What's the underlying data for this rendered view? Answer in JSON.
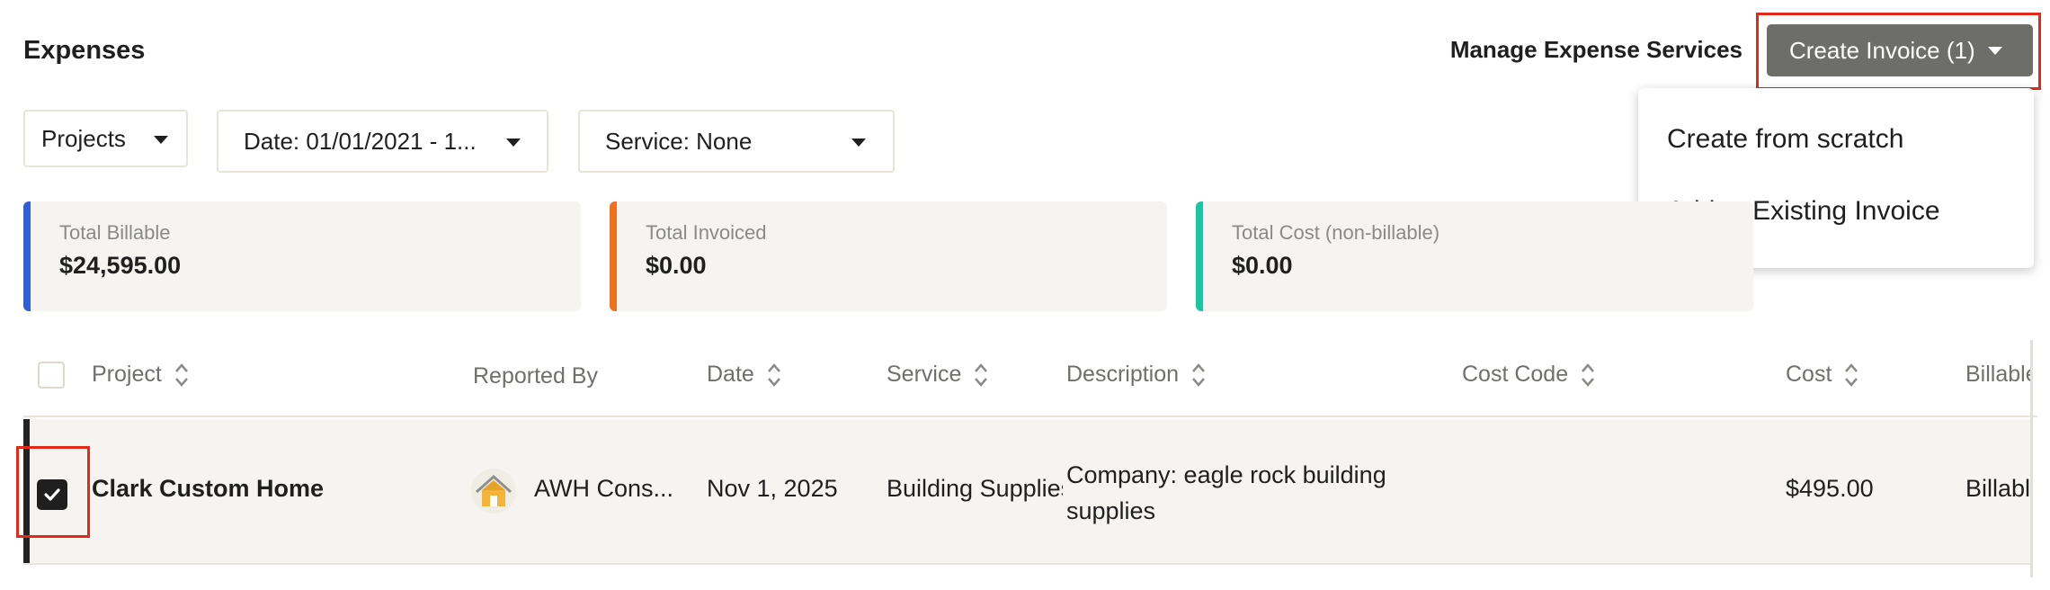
{
  "header": {
    "title": "Expenses",
    "manage_label": "Manage Expense Services",
    "create_invoice_label": "Create Invoice (1)"
  },
  "dropdown": {
    "items": [
      "Create from scratch",
      "Add to Existing Invoice"
    ]
  },
  "filters": {
    "projects": "Projects",
    "date": "Date: 01/01/2021 - 1...",
    "service": "Service: None"
  },
  "stats": [
    {
      "label": "Total Billable",
      "value": "$24,595.00",
      "color": "#2f5fd6"
    },
    {
      "label": "Total Invoiced",
      "value": "$0.00",
      "color": "#f0701e"
    },
    {
      "label": "Total Cost (non-billable)",
      "value": "$0.00",
      "color": "#18c7a4"
    }
  ],
  "table": {
    "columns": [
      "Project",
      "Reported By",
      "Date",
      "Service",
      "Description",
      "Cost Code",
      "Cost",
      "Billable"
    ],
    "rows": [
      {
        "project": "Clark Custom Home",
        "reported_by": "AWH Cons...",
        "date": "Nov 1, 2025",
        "service": "Building Supplies",
        "description": "Company: eagle rock building supplies",
        "cost_code": "",
        "cost": "$495.00",
        "billable": "Billable",
        "selected": true
      }
    ]
  },
  "colors": {
    "accent_highlight": "#e12a1a",
    "button_bg": "#6d6d69",
    "row_bg": "#f5f4f1"
  }
}
